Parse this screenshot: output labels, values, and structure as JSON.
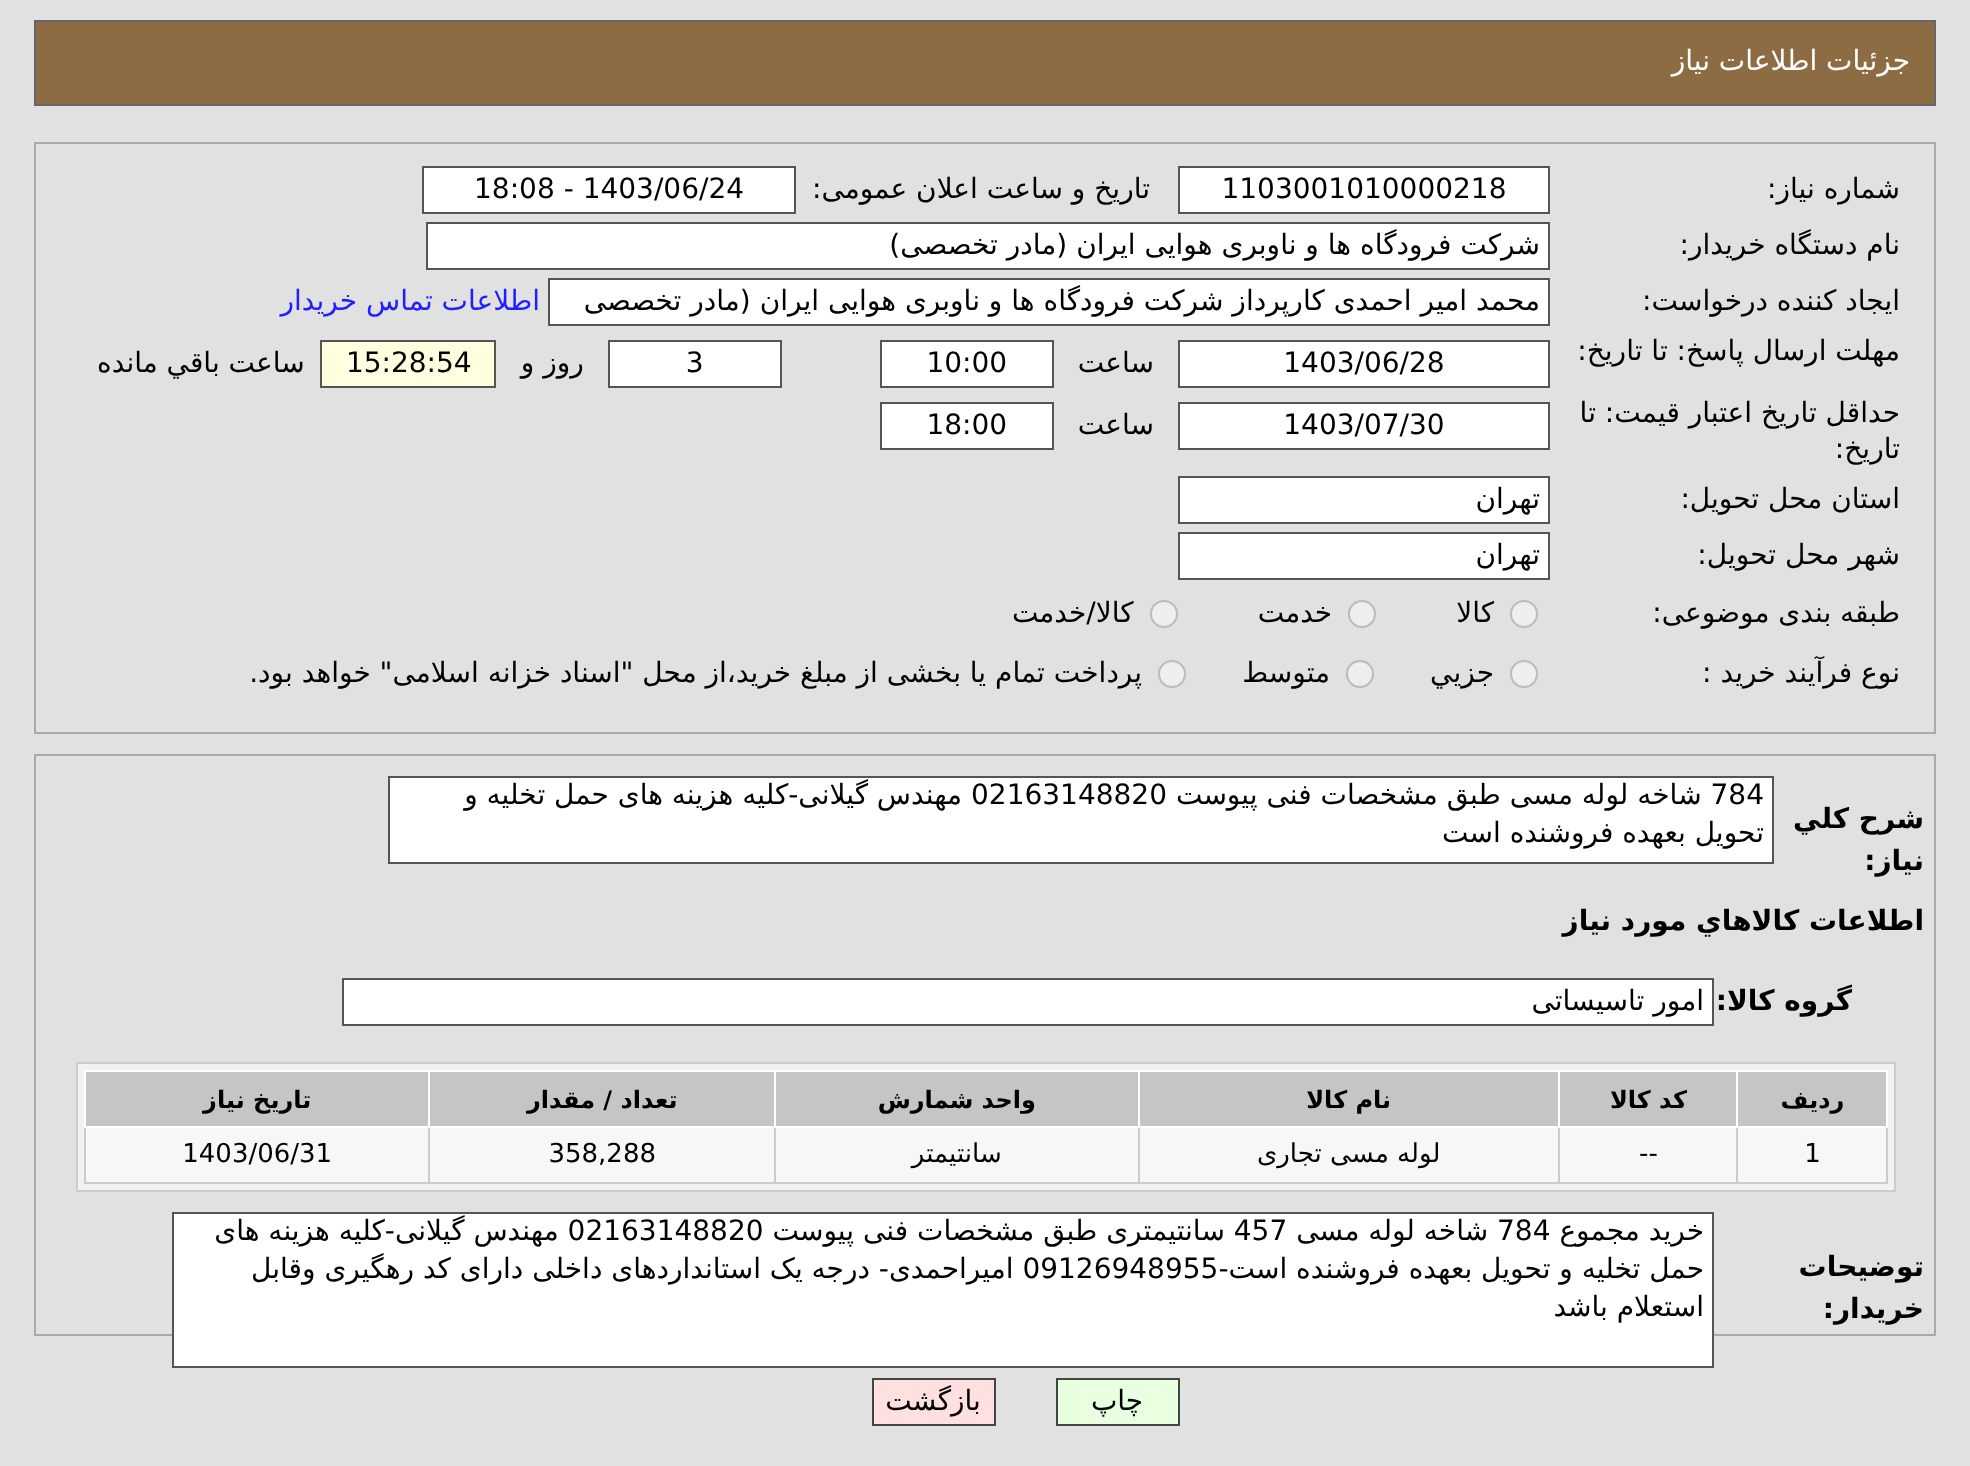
{
  "header": {
    "title": "جزئیات اطلاعات نیاز"
  },
  "need_number": {
    "label": "شماره نیاز:",
    "value": "1103001010000218"
  },
  "announce": {
    "label": "تاریخ و ساعت اعلان عمومی:",
    "value": "1403/06/24 - 18:08"
  },
  "buyer_org": {
    "label": "نام دستگاه خریدار:",
    "value": "شرکت فرودگاه ها و ناوبری هوایی ایران (مادر تخصصی)"
  },
  "creator": {
    "label": "ایجاد کننده درخواست:",
    "value": "محمد امیر احمدی کارپرداز شرکت فرودگاه ها و ناوبری هوایی ایران (مادر تخصصی",
    "link": "اطلاعات تماس خریدار"
  },
  "reply_deadline": {
    "label": "مهلت ارسال پاسخ: تا تاریخ:",
    "date": "1403/06/28",
    "time_label": "ساعت",
    "time": "10:00",
    "days": "3",
    "days_label": "روز و",
    "remaining": "15:28:54",
    "remaining_label": "ساعت باقي مانده"
  },
  "price_validity": {
    "label": "حداقل تاریخ اعتبار قیمت: تا تاریخ:",
    "date": "1403/07/30",
    "time_label": "ساعت",
    "time": "18:00"
  },
  "province": {
    "label": "استان محل تحویل:",
    "value": "تهران"
  },
  "city": {
    "label": "شهر محل تحویل:",
    "value": "تهران"
  },
  "category": {
    "label": "طبقه بندی موضوعی:",
    "options": [
      {
        "label": "کالا",
        "selected": false
      },
      {
        "label": "خدمت",
        "selected": false
      },
      {
        "label": "کالا/خدمت",
        "selected": false
      }
    ]
  },
  "purchase_type": {
    "label": "نوع فرآیند خرید :",
    "options": [
      {
        "label": "جزيي",
        "selected": false
      },
      {
        "label": "متوسط",
        "selected": false
      },
      {
        "label": "پرداخت تمام یا بخشی از مبلغ خرید،از محل \"اسناد خزانه اسلامی\" خواهد بود.",
        "selected": false
      }
    ]
  },
  "description": {
    "label": "شرح کلي نیاز:",
    "value": "784 شاخه لوله مسی طبق مشخصات فنی پیوست 02163148820 مهندس گیلانی-کلیه هزینه های حمل تخلیه و تحویل بعهده فروشنده است"
  },
  "goods_title": "اطلاعات کالاهاي مورد نیاز",
  "goods_group": {
    "label": "گروه کالا:",
    "value": "امور تاسیساتی"
  },
  "table": {
    "columns": [
      "ردیف",
      "کد کالا",
      "نام کالا",
      "واحد شمارش",
      "تعداد / مقدار",
      "تاریخ نیاز"
    ],
    "rows": [
      [
        "1",
        "--",
        "لوله مسی تجاری",
        "سانتیمتر",
        "358,288",
        "1403/06/31"
      ]
    ]
  },
  "buyer_notes": {
    "label": "توضیحات خریدار:",
    "value": "خرید مجموع 784 شاخه لوله مسی 457 سانتیمتری طبق مشخصات فنی پیوست 02163148820 مهندس گیلانی-کلیه هزینه های حمل تخلیه و تحویل بعهده فروشنده است-09126948955 امیراحمدی- درجه یک استانداردهای داخلی دارای کد رهگیری وقابل استعلام باشد"
  },
  "buttons": [
    {
      "kind": "print",
      "label": "چاپ"
    },
    {
      "kind": "back",
      "label": "بازگشت"
    }
  ]
}
